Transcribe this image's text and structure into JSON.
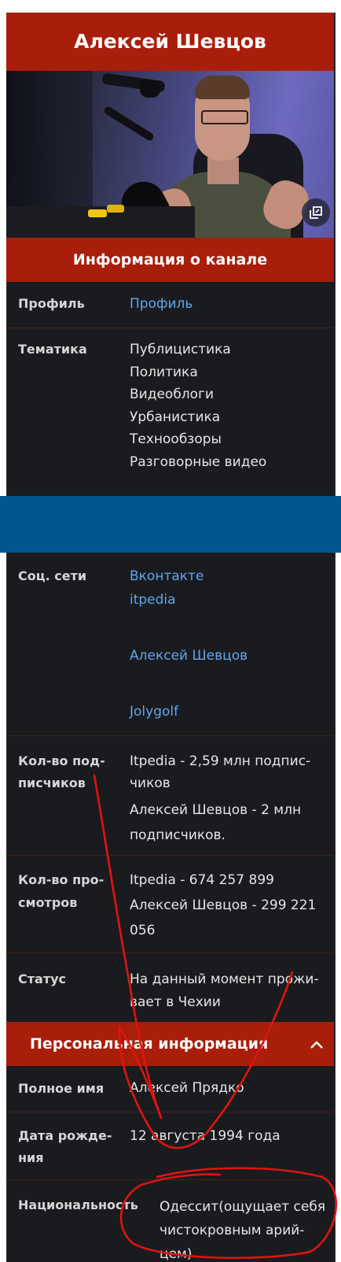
{
  "title": "Алексей Шевцов",
  "section_channel": "Информация о канале",
  "profile": {
    "label": "Профиль",
    "value": "Профиль"
  },
  "topics": {
    "label": "Тематика",
    "items": [
      "Публицистика",
      "Политика",
      "Видеоблоги",
      "Урбанистика",
      "Технообзоры",
      "Разговорные видео"
    ]
  },
  "social": {
    "label": "Соц. сети",
    "links": [
      "Вконтакте",
      "itpedia",
      "Алексей Шевцов",
      "Jolygolf"
    ]
  },
  "subscribers": {
    "label_line1": "Кол-во под-",
    "label_line2": "писчиков",
    "lines": [
      "Itpedia - 2,59 млн подпис-",
      "чиков",
      "Алексей Шевцов - 2 млн",
      "подписчиков."
    ]
  },
  "views": {
    "label_line1": "Кол-во про-",
    "label_line2": "смотров",
    "lines": [
      "Itpedia - 674 257 899",
      "Алексей Шевцов - 299 221",
      "056"
    ]
  },
  "status": {
    "label": "Статус",
    "lines": [
      "На данный момент прожи-",
      "вает в Чехии"
    ]
  },
  "section_personal": "Персональная информация",
  "full_name": {
    "label": "Полное имя",
    "value": "Алексей Прядко"
  },
  "birth": {
    "label_line1": "Дата рожде-",
    "label_line2": "ния",
    "value": "12 августа 1994 года"
  },
  "nationality": {
    "label": "Национальность",
    "lines": [
      "Одессит(ощущает себя",
      "чистокровным арий-",
      "цем)"
    ]
  },
  "icons": {
    "expand": "expand-image-icon",
    "collapse": "chevron-up-icon"
  },
  "colors": {
    "accent": "#a81e0a",
    "link": "#5fa6ee",
    "band": "#02558f",
    "background": "#1a1b1e",
    "annotation": "#e0140f"
  }
}
